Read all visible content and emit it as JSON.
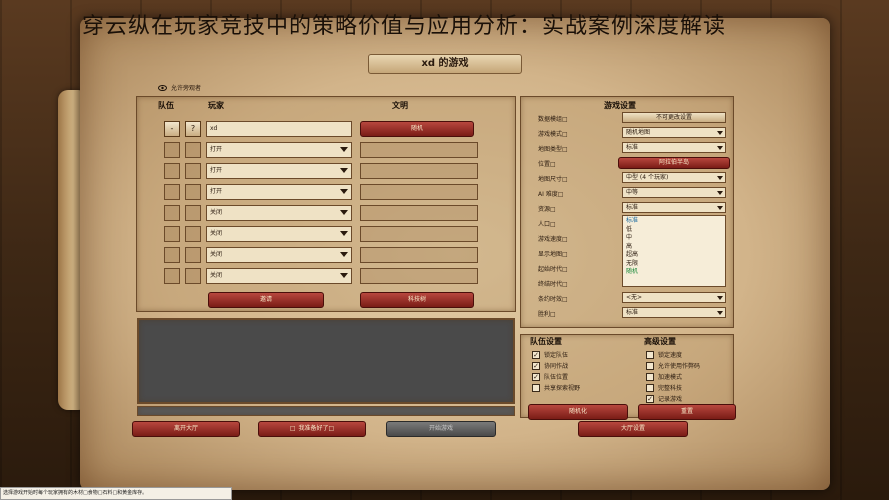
{
  "headline": "穿云纵在玩家竞技中的策略价值与应用分析：实战案例深度解读",
  "window_title": "xd 的游戏",
  "spectate_label": "允许旁观者",
  "players": {
    "col_team": "队伍",
    "col_player": "玩家",
    "col_civ": "文明",
    "host_btn_minus": "-",
    "host_btn_q": "?",
    "rows": [
      {
        "name": "xd",
        "civ": "随机"
      },
      {
        "name": "打开",
        "civ": ""
      },
      {
        "name": "打开",
        "civ": ""
      },
      {
        "name": "打开",
        "civ": ""
      },
      {
        "name": "关闭",
        "civ": ""
      },
      {
        "name": "关闭",
        "civ": ""
      },
      {
        "name": "关闭",
        "civ": ""
      },
      {
        "name": "关闭",
        "civ": ""
      }
    ],
    "invite_button": "邀请",
    "tech_tree_button": "科技树"
  },
  "game_settings": {
    "title": "游戏设置",
    "rows": [
      {
        "label": "数据模组□",
        "value": "不可更改设置",
        "kind": "button"
      },
      {
        "label": "游戏模式□",
        "value": "随机地图",
        "kind": "dropdown"
      },
      {
        "label": "地图类型□",
        "value": "标准",
        "kind": "dropdown"
      },
      {
        "label": "位置□",
        "value": "阿拉伯半岛",
        "kind": "red"
      },
      {
        "label": "地图尺寸□",
        "value": "中型 (4 个玩家)",
        "kind": "dropdown"
      },
      {
        "label": "AI 难度□",
        "value": "中等",
        "kind": "dropdown"
      },
      {
        "label": "资源□",
        "value": "标准",
        "kind": "dropdown"
      },
      {
        "label": "人口□",
        "value": "",
        "kind": "none"
      },
      {
        "label": "游戏速度□",
        "value": "",
        "kind": "none"
      },
      {
        "label": "显示地图□",
        "value": "",
        "kind": "none"
      },
      {
        "label": "起始时代□",
        "value": "",
        "kind": "none"
      },
      {
        "label": "终结时代□",
        "value": "",
        "kind": "none"
      },
      {
        "label": "条约时效□",
        "value": "<无>",
        "kind": "dropdown"
      },
      {
        "label": "胜利□",
        "value": "标准",
        "kind": "dropdown"
      }
    ],
    "resource_options": [
      "标准",
      "低",
      "中",
      "高",
      "超高",
      "无限",
      "随机"
    ]
  },
  "team_settings": {
    "title": "队伍设置",
    "items": [
      {
        "label": "锁定队伍",
        "checked": true
      },
      {
        "label": "协同作战",
        "checked": true
      },
      {
        "label": "队伍位置",
        "checked": true
      },
      {
        "label": "共享探索视野",
        "checked": false
      }
    ]
  },
  "advanced_settings": {
    "title": "高级设置",
    "items": [
      {
        "label": "锁定速度",
        "checked": false
      },
      {
        "label": "允许使用作弊码",
        "checked": false
      },
      {
        "label": "加速模式",
        "checked": false
      },
      {
        "label": "完整科技",
        "checked": false
      },
      {
        "label": "记录游戏",
        "checked": true
      }
    ]
  },
  "bottom": {
    "leave_lobby": "离开大厅",
    "ready_check": "□",
    "ready_label": "我准备好了□",
    "start_game": "开始游戏",
    "randomize": "随机化",
    "reset": "重置",
    "lobby_settings": "大厅设置"
  },
  "status_text": "选择游戏开始时每个玩家拥有的木材□食物□石料□和黄金库存。",
  "checkmark": "✓"
}
